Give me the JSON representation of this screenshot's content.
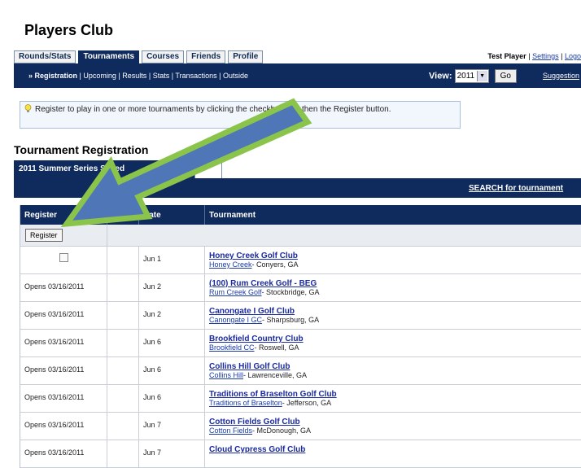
{
  "page_title": "Players Club",
  "tabs": [
    {
      "label": "Rounds/Stats",
      "active": false
    },
    {
      "label": "Tournaments",
      "active": true
    },
    {
      "label": "Courses",
      "active": false
    },
    {
      "label": "Friends",
      "active": false
    },
    {
      "label": "Profile",
      "active": false
    }
  ],
  "user": {
    "name": "Test Player",
    "sep1": "|",
    "settings": "Settings",
    "sep2": "|",
    "logout": "Logo"
  },
  "subnav": {
    "items": [
      "» Registration",
      "Upcoming",
      "Results",
      "Stats",
      "Transactions",
      "Outside"
    ],
    "separator": "|",
    "view_label": "View:",
    "view_value": "2011",
    "go_label": "Go",
    "suggestions": "Suggestion"
  },
  "info": {
    "text": "Register to play in one or more tournaments by clicking the checkbox and then the Register button."
  },
  "section_title": "Tournament Registration",
  "schedule_tab": "2011 Summer Series Sched",
  "search_link": "SEARCH for tournament",
  "table": {
    "headers": [
      "Register",
      "",
      "Date",
      "Tournament"
    ],
    "register_button": "Register",
    "rows": [
      {
        "register": "",
        "checkbox": true,
        "date": "Jun 1",
        "name": "Honey Creek Golf Club",
        "course": "Honey Creek",
        "location": "- Conyers, GA"
      },
      {
        "register": "Opens 03/16/2011",
        "checkbox": false,
        "date": "Jun 2",
        "name": "(100) Rum Creek Golf - BEG",
        "course": "Rum Creek Golf",
        "location": "- Stockbridge, GA"
      },
      {
        "register": "Opens 03/16/2011",
        "checkbox": false,
        "date": "Jun 2",
        "name": "Canongate I Golf Club",
        "course": "Canongate I GC",
        "location": "- Sharpsburg, GA"
      },
      {
        "register": "Opens 03/16/2011",
        "checkbox": false,
        "date": "Jun 6",
        "name": "Brookfield Country Club",
        "course": "Brookfield CC",
        "location": "- Roswell, GA"
      },
      {
        "register": "Opens 03/16/2011",
        "checkbox": false,
        "date": "Jun 6",
        "name": "Collins Hill Golf Club",
        "course": "Collins Hill",
        "location": "- Lawrenceville, GA"
      },
      {
        "register": "Opens 03/16/2011",
        "checkbox": false,
        "date": "Jun 6",
        "name": "Traditions of Braselton Golf Club",
        "course": "Traditions of Braselton",
        "location": "- Jefferson, GA"
      },
      {
        "register": "Opens 03/16/2011",
        "checkbox": false,
        "date": "Jun 7",
        "name": "Cotton Fields Golf Club",
        "course": "Cotton Fields",
        "location": "- McDonough, GA"
      },
      {
        "register": "Opens 03/16/2011",
        "checkbox": false,
        "date": "Jun 7",
        "name": "Cloud Cypress Golf Club",
        "course": "",
        "location": ""
      }
    ]
  },
  "colors": {
    "navy": "#0f2a5c",
    "link": "#1a2aa0",
    "arrow_fill": "#4f77b8",
    "arrow_outline": "#8ac44a"
  },
  "icons": {
    "info": "lightbulb-icon",
    "dropdown": "chevron-down-icon",
    "annotation": "arrow-pointer-icon"
  }
}
